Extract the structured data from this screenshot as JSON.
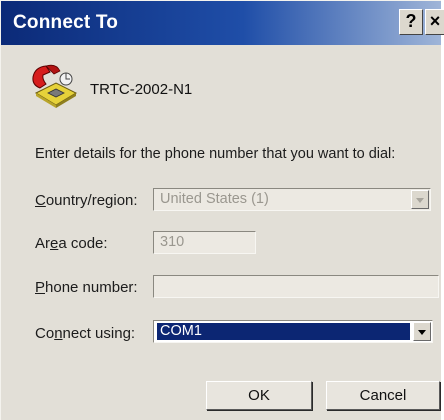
{
  "window": {
    "title": "Connect To",
    "help_label": "?",
    "close_label": "×"
  },
  "connection": {
    "name": "TRTC-2002-N1",
    "icon": "phone-icon"
  },
  "instruction": "Enter details for the phone number that you want to dial:",
  "form": {
    "country": {
      "label_pre": "",
      "label_key": "C",
      "label_post": "ountry/region:",
      "value": "United States (1)",
      "disabled": true
    },
    "area": {
      "label_pre": "Ar",
      "label_key": "e",
      "label_post": "a code:",
      "value": "310",
      "disabled": true
    },
    "phone": {
      "label_pre": "",
      "label_key": "P",
      "label_post": "hone number:",
      "value": "",
      "disabled": true
    },
    "connect": {
      "label_pre": "Co",
      "label_key": "n",
      "label_post": "nect using:",
      "value": "COM1",
      "disabled": false
    }
  },
  "buttons": {
    "ok": "OK",
    "cancel": "Cancel"
  },
  "colors": {
    "title_start": "#0b2a78",
    "title_end": "#9fb5d8",
    "dialog_bg": "#e2dfd7",
    "selection": "#0c2673"
  }
}
